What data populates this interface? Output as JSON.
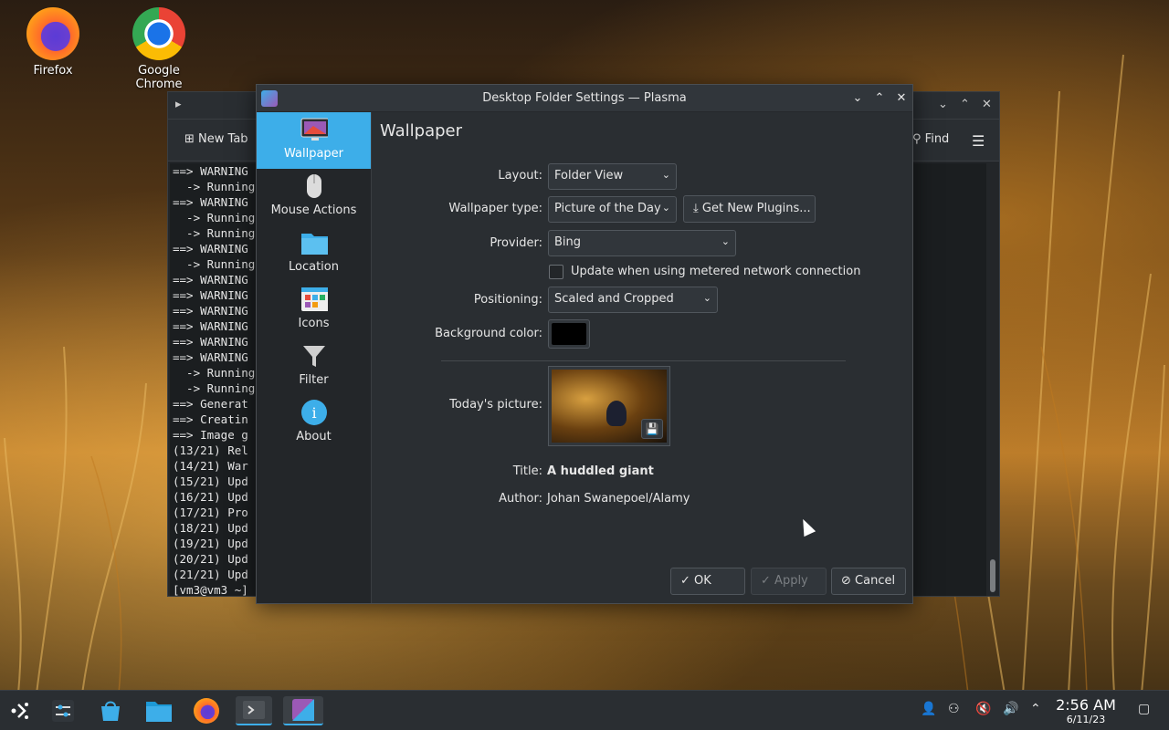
{
  "desktop": {
    "icons": [
      {
        "label": "Firefox"
      },
      {
        "label": "Google Chrome"
      }
    ]
  },
  "terminal": {
    "new_tab_label": "New Tab",
    "find_label": "Find",
    "lines": [
      "==> WARNING",
      "  -> Running",
      "==> WARNING",
      "  -> Running",
      "  -> Running",
      "==> WARNING",
      "  -> Running",
      "==> WARNING",
      "==> WARNING",
      "==> WARNING",
      "==> WARNING",
      "==> WARNING",
      "==> WARNING",
      "  -> Running",
      "  -> Running",
      "==> Generat",
      "==> Creatin",
      "==> Image g",
      "(13/21) Rel",
      "(14/21) War",
      "(15/21) Upd",
      "(16/21) Upd",
      "(17/21) Pro",
      "(18/21) Upd",
      "(19/21) Upd",
      "(20/21) Upd",
      "(21/21) Upd",
      "[vm3@vm3 ~]"
    ]
  },
  "dialog": {
    "title": "Desktop Folder Settings — Plasma",
    "sidebar": [
      {
        "label": "Wallpaper",
        "icon": "wallpaper-icon",
        "active": true
      },
      {
        "label": "Mouse Actions",
        "icon": "mouse-icon",
        "active": false
      },
      {
        "label": "Location",
        "icon": "folder-icon",
        "active": false
      },
      {
        "label": "Icons",
        "icon": "icons-icon",
        "active": false
      },
      {
        "label": "Filter",
        "icon": "filter-icon",
        "active": false
      },
      {
        "label": "About",
        "icon": "info-icon",
        "active": false
      }
    ],
    "page_title": "Wallpaper",
    "layout_label": "Layout:",
    "layout_value": "Folder View",
    "wallpaper_type_label": "Wallpaper type:",
    "wallpaper_type_value": "Picture of the Day",
    "get_plugins_label": "Get New Plugins...",
    "provider_label": "Provider:",
    "provider_value": "Bing",
    "metered_label": "Update when using metered network connection",
    "metered_checked": false,
    "positioning_label": "Positioning:",
    "positioning_value": "Scaled and Cropped",
    "bg_color_label": "Background color:",
    "bg_color": "#000000",
    "todays_picture_label": "Today's picture:",
    "title_label": "Title:",
    "title_value": "A huddled giant",
    "author_label": "Author:",
    "author_value": "Johan Swanepoel/Alamy",
    "ok_label": "OK",
    "apply_label": "Apply",
    "cancel_label": "Cancel"
  },
  "taskbar": {
    "time": "2:56 AM",
    "date": "6/11/23"
  },
  "colors": {
    "accent": "#3daee9",
    "window_bg": "#2a2e32",
    "sidebar_bg": "#232629"
  }
}
